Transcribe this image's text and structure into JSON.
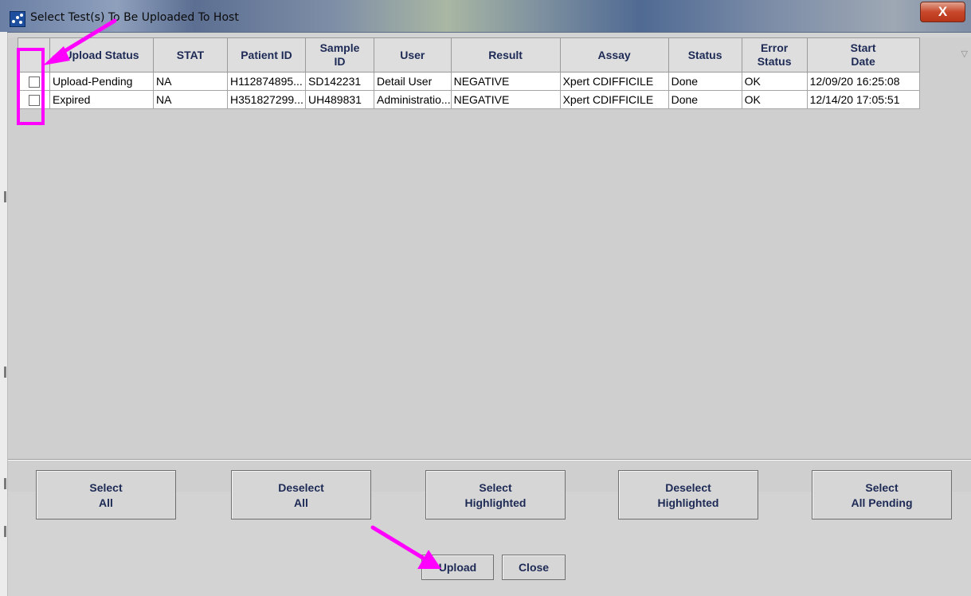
{
  "window": {
    "title": "Select Test(s) To Be Uploaded To Host",
    "close_glyph": "X"
  },
  "table": {
    "columns": [
      "",
      "Upload Status",
      "STAT",
      "Patient ID",
      "Sample\nID",
      "User",
      "Result",
      "Assay",
      "Status",
      "Error\nStatus",
      "Start\nDate"
    ],
    "rows": [
      {
        "checked": false,
        "upload_status": "Upload-Pending",
        "stat": "NA",
        "patient_id": "H112874895...",
        "sample_id": "SD142231",
        "user": "Detail User",
        "result": "NEGATIVE",
        "assay": "Xpert CDIFFICILE",
        "status": "Done",
        "error_status": "OK",
        "start_date": "12/09/20 16:25:08"
      },
      {
        "checked": false,
        "upload_status": "Expired",
        "stat": "NA",
        "patient_id": "H351827299...",
        "sample_id": "UH489831",
        "user": "Administratio...",
        "result": "NEGATIVE",
        "assay": "Xpert CDIFFICILE",
        "status": "Done",
        "error_status": "OK",
        "start_date": "12/14/20 17:05:51"
      }
    ],
    "sort_indicator": "▽"
  },
  "buttons": {
    "select_all": [
      "Select",
      "All"
    ],
    "deselect_all": [
      "Deselect",
      "All"
    ],
    "select_highlighted": [
      "Select",
      "Highlighted"
    ],
    "deselect_highlighted": [
      "Deselect",
      "Highlighted"
    ],
    "select_all_pending": [
      "Select",
      "All Pending"
    ],
    "upload": "Upload",
    "close": "Close"
  },
  "annotation_color": "#ff00ff"
}
